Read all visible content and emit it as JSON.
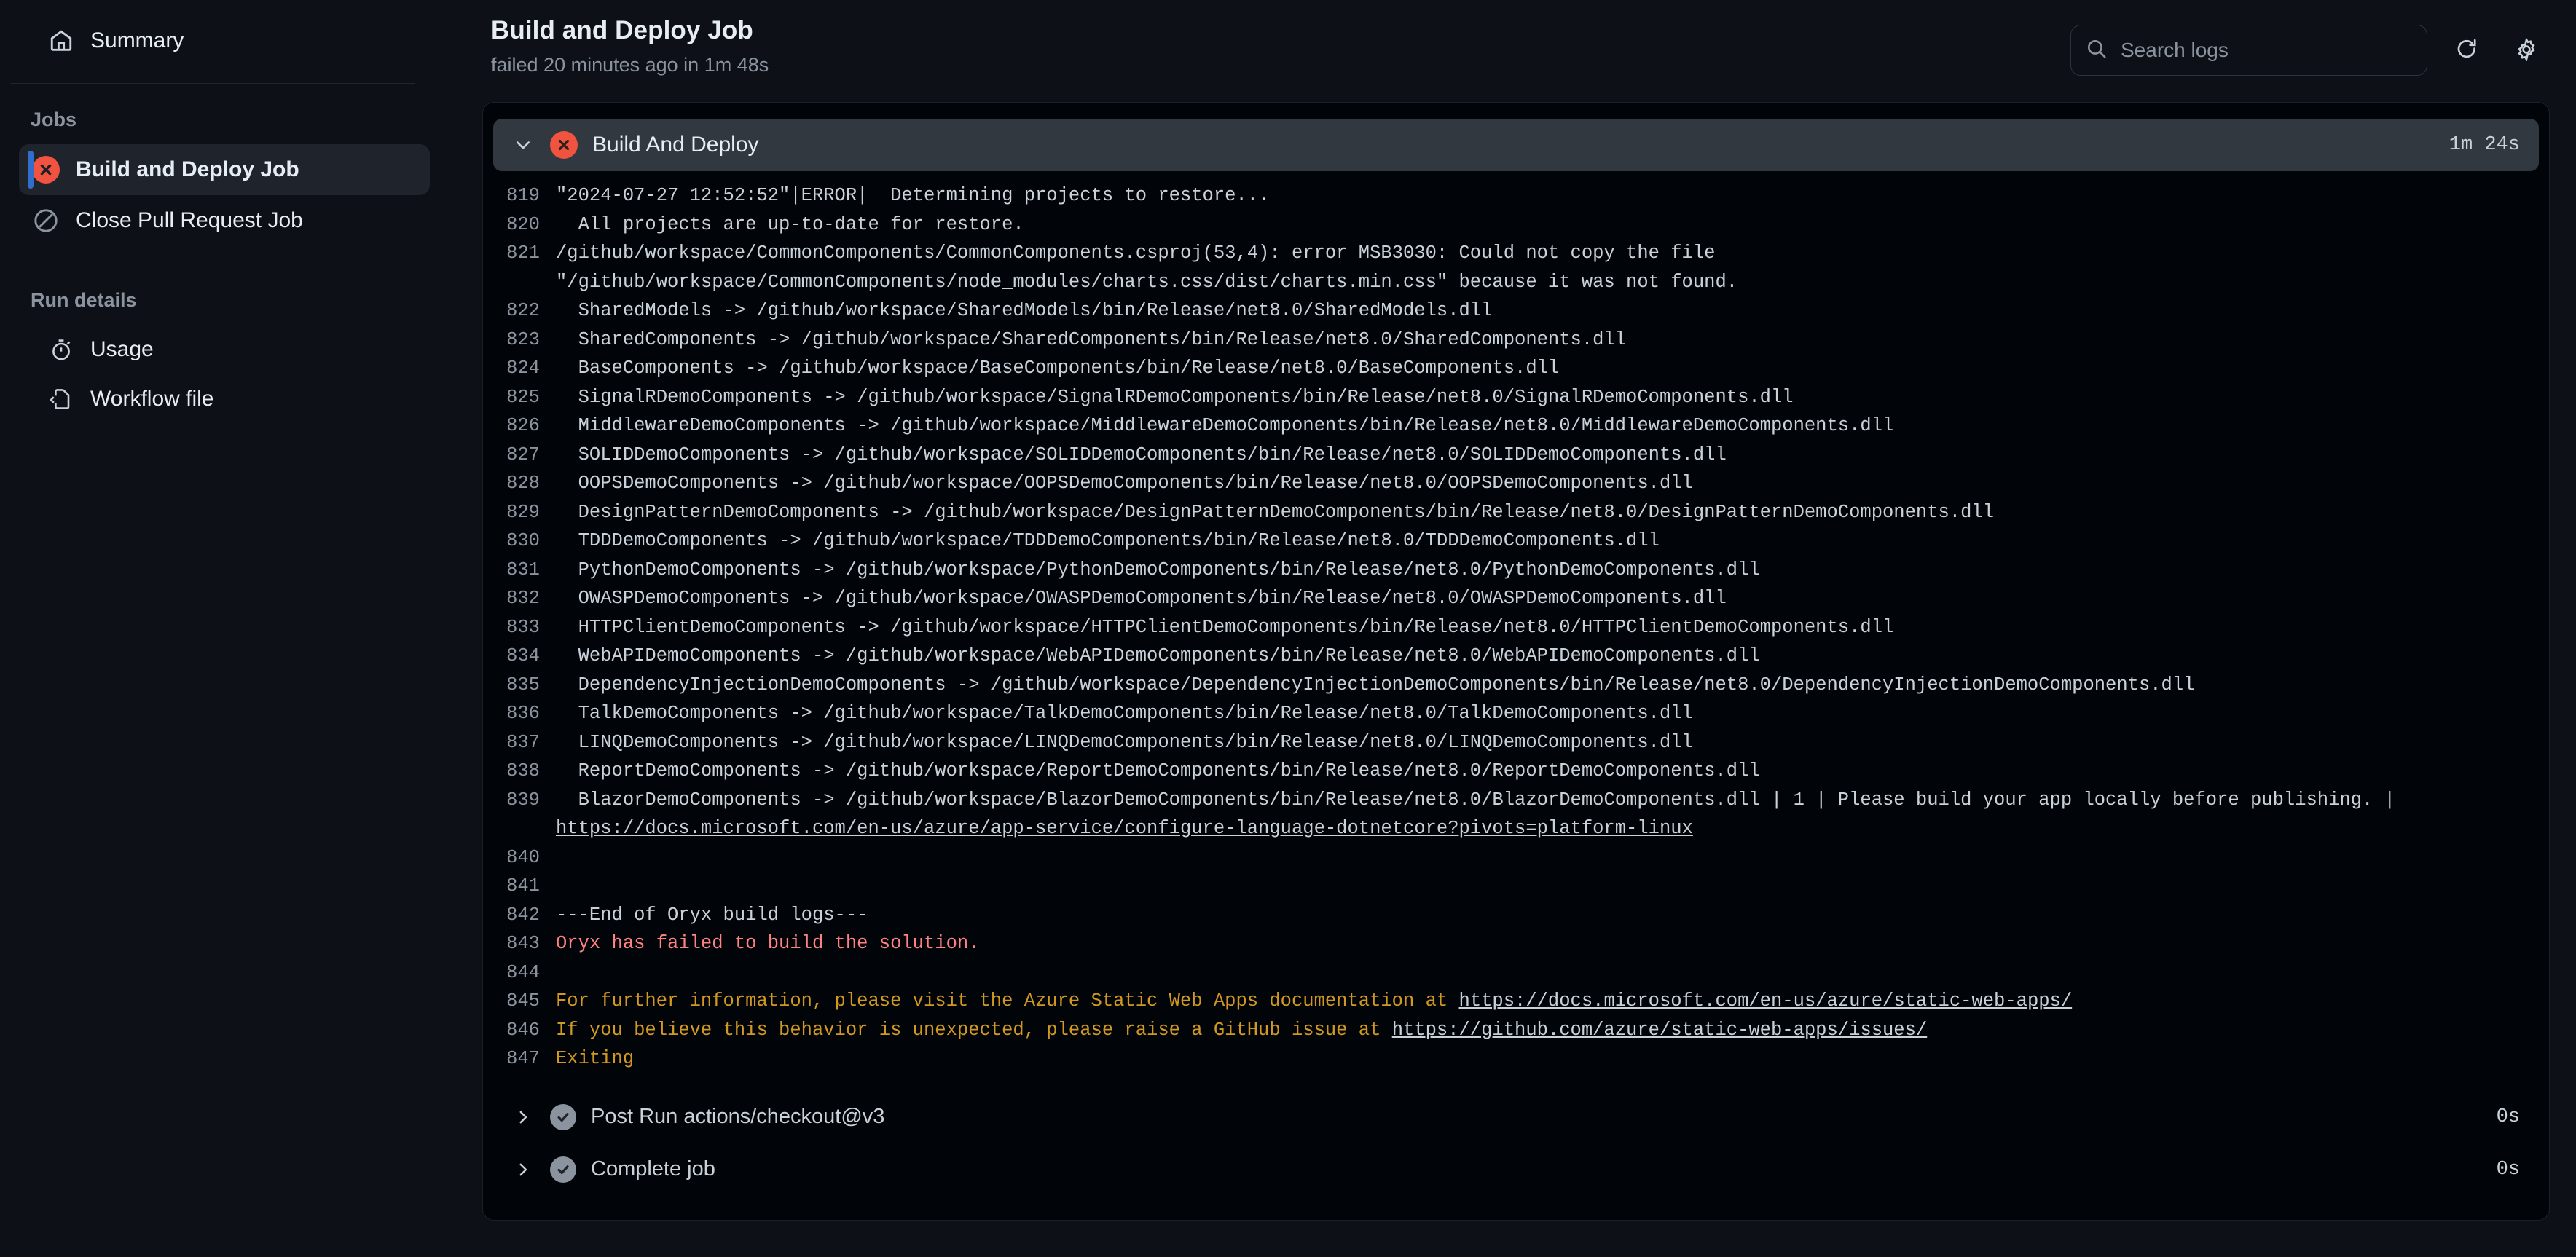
{
  "sidebar": {
    "summary": {
      "label": "Summary",
      "icon": "home-icon"
    },
    "jobs_heading": "Jobs",
    "jobs": [
      {
        "label": "Build and Deploy Job",
        "status": "failed",
        "icon": "x-circle-icon",
        "selected": true
      },
      {
        "label": "Close Pull Request Job",
        "status": "skipped",
        "icon": "skip-circle-icon",
        "selected": false
      }
    ],
    "run_details_heading": "Run details",
    "run_details": [
      {
        "label": "Usage",
        "icon": "stopwatch-icon"
      },
      {
        "label": "Workflow file",
        "icon": "file-code-icon"
      }
    ]
  },
  "header": {
    "title": "Build and Deploy Job",
    "subtitle": "failed 20 minutes ago in 1m 48s",
    "search_placeholder": "Search logs",
    "search_value": "",
    "refresh_icon": "refresh-icon",
    "settings_icon": "gear-icon"
  },
  "colors": {
    "accent_selected": "#316dca",
    "failure_red": "#f0533f",
    "log_error_text": "#ff8182",
    "log_warn_text": "#d29922",
    "panel_bg": "#010409",
    "page_bg": "#0d1117",
    "step_header_bg": "#32383f"
  },
  "step": {
    "name": "Build And Deploy",
    "status": "failed",
    "duration": "1m 24s",
    "expanded": true,
    "chevron": "chevron-down-icon"
  },
  "log_lines": [
    {
      "n": "819",
      "text": "\"2024-07-27 12:52:52\"|ERROR|  Determining projects to restore...",
      "style": "normal"
    },
    {
      "n": "820",
      "text": "  All projects are up-to-date for restore.",
      "style": "normal"
    },
    {
      "n": "821",
      "text": "/github/workspace/CommonComponents/CommonComponents.csproj(53,4): error MSB3030: Could not copy the file \"/github/workspace/CommonComponents/node_modules/charts.css/dist/charts.min.css\" because it was not found.",
      "style": "normal",
      "wrap": true
    },
    {
      "n": "822",
      "text": "  SharedModels -> /github/workspace/SharedModels/bin/Release/net8.0/SharedModels.dll",
      "style": "normal"
    },
    {
      "n": "823",
      "text": "  SharedComponents -> /github/workspace/SharedComponents/bin/Release/net8.0/SharedComponents.dll",
      "style": "normal"
    },
    {
      "n": "824",
      "text": "  BaseComponents -> /github/workspace/BaseComponents/bin/Release/net8.0/BaseComponents.dll",
      "style": "normal"
    },
    {
      "n": "825",
      "text": "  SignalRDemoComponents -> /github/workspace/SignalRDemoComponents/bin/Release/net8.0/SignalRDemoComponents.dll",
      "style": "normal"
    },
    {
      "n": "826",
      "text": "  MiddlewareDemoComponents -> /github/workspace/MiddlewareDemoComponents/bin/Release/net8.0/MiddlewareDemoComponents.dll",
      "style": "normal"
    },
    {
      "n": "827",
      "text": "  SOLIDDemoComponents -> /github/workspace/SOLIDDemoComponents/bin/Release/net8.0/SOLIDDemoComponents.dll",
      "style": "normal"
    },
    {
      "n": "828",
      "text": "  OOPSDemoComponents -> /github/workspace/OOPSDemoComponents/bin/Release/net8.0/OOPSDemoComponents.dll",
      "style": "normal"
    },
    {
      "n": "829",
      "text": "  DesignPatternDemoComponents -> /github/workspace/DesignPatternDemoComponents/bin/Release/net8.0/DesignPatternDemoComponents.dll",
      "style": "normal"
    },
    {
      "n": "830",
      "text": "  TDDDemoComponents -> /github/workspace/TDDDemoComponents/bin/Release/net8.0/TDDDemoComponents.dll",
      "style": "normal"
    },
    {
      "n": "831",
      "text": "  PythonDemoComponents -> /github/workspace/PythonDemoComponents/bin/Release/net8.0/PythonDemoComponents.dll",
      "style": "normal"
    },
    {
      "n": "832",
      "text": "  OWASPDemoComponents -> /github/workspace/OWASPDemoComponents/bin/Release/net8.0/OWASPDemoComponents.dll",
      "style": "normal"
    },
    {
      "n": "833",
      "text": "  HTTPClientDemoComponents -> /github/workspace/HTTPClientDemoComponents/bin/Release/net8.0/HTTPClientDemoComponents.dll",
      "style": "normal"
    },
    {
      "n": "834",
      "text": "  WebAPIDemoComponents -> /github/workspace/WebAPIDemoComponents/bin/Release/net8.0/WebAPIDemoComponents.dll",
      "style": "normal"
    },
    {
      "n": "835",
      "text": "  DependencyInjectionDemoComponents -> /github/workspace/DependencyInjectionDemoComponents/bin/Release/net8.0/DependencyInjectionDemoComponents.dll",
      "style": "normal"
    },
    {
      "n": "836",
      "text": "  TalkDemoComponents -> /github/workspace/TalkDemoComponents/bin/Release/net8.0/TalkDemoComponents.dll",
      "style": "normal"
    },
    {
      "n": "837",
      "text": "  LINQDemoComponents -> /github/workspace/LINQDemoComponents/bin/Release/net8.0/LINQDemoComponents.dll",
      "style": "normal"
    },
    {
      "n": "838",
      "text": "  ReportDemoComponents -> /github/workspace/ReportDemoComponents/bin/Release/net8.0/ReportDemoComponents.dll",
      "style": "normal"
    },
    {
      "n": "839",
      "style": "normal",
      "wrap": true,
      "segments": [
        {
          "t": "  BlazorDemoComponents -> /github/workspace/BlazorDemoComponents/bin/Release/net8.0/BlazorDemoComponents.dll | 1 | Please build your app locally before publishing. | ",
          "link": false
        },
        {
          "t": "https://docs.microsoft.com/en-us/azure/app-service/configure-language-dotnetcore?pivots=platform-linux",
          "link": true
        }
      ]
    },
    {
      "n": "840",
      "text": "",
      "style": "normal"
    },
    {
      "n": "841",
      "text": "",
      "style": "normal"
    },
    {
      "n": "842",
      "text": "---End of Oryx build logs---",
      "style": "normal"
    },
    {
      "n": "843",
      "text": "Oryx has failed to build the solution.",
      "style": "error"
    },
    {
      "n": "844",
      "text": "",
      "style": "normal"
    },
    {
      "n": "845",
      "style": "warn",
      "segments": [
        {
          "t": "For further information, please visit the Azure Static Web Apps documentation at ",
          "link": false
        },
        {
          "t": "https://docs.microsoft.com/en-us/azure/static-web-apps/",
          "link": true
        }
      ]
    },
    {
      "n": "846",
      "style": "warn",
      "segments": [
        {
          "t": "If you believe this behavior is unexpected, please raise a GitHub issue at ",
          "link": false
        },
        {
          "t": "https://github.com/azure/static-web-apps/issues/",
          "link": true
        }
      ]
    },
    {
      "n": "847",
      "text": "Exiting",
      "style": "warn"
    }
  ],
  "collapsed_steps": [
    {
      "label": "Post Run actions/checkout@v3",
      "duration": "0s",
      "status": "success",
      "chevron": "chevron-right-icon"
    },
    {
      "label": "Complete job",
      "duration": "0s",
      "status": "success",
      "chevron": "chevron-right-icon"
    }
  ]
}
